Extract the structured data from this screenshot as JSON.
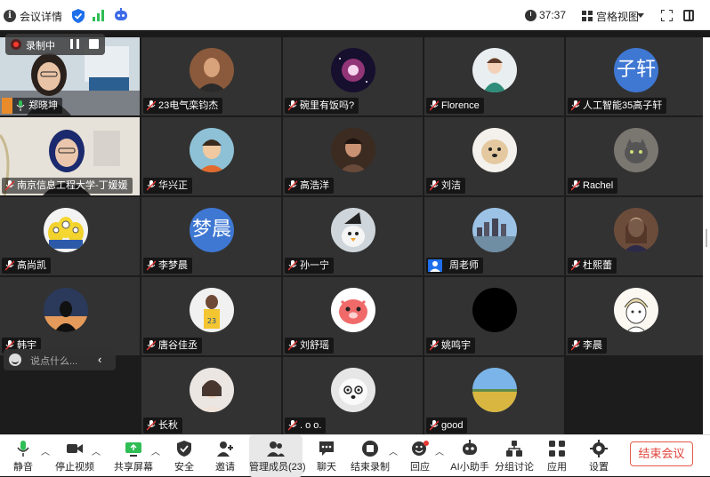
{
  "header": {
    "title": "会议详情",
    "timer": "37:37",
    "view_label": "宫格视图"
  },
  "recording": {
    "label": "录制中"
  },
  "participants": [
    {
      "name": "郑晓坤",
      "type": "video"
    },
    {
      "name": "23电气栾钧杰",
      "type": "avatar"
    },
    {
      "name": "碗里有饭吗?",
      "type": "avatar"
    },
    {
      "name": "Florence",
      "type": "avatar"
    },
    {
      "name": "人工智能35高子轩",
      "type": "avatar",
      "avatar_text": "子轩"
    },
    {
      "name": "南京信息工程大学-丁媛媛",
      "type": "video"
    },
    {
      "name": "华兴正",
      "type": "avatar"
    },
    {
      "name": "高浩洋",
      "type": "avatar"
    },
    {
      "name": "刘洁",
      "type": "avatar"
    },
    {
      "name": "Rachel",
      "type": "avatar"
    },
    {
      "name": "高尚凯",
      "type": "avatar"
    },
    {
      "name": "李梦晨",
      "type": "avatar",
      "avatar_text": "梦晨"
    },
    {
      "name": "孙一宁",
      "type": "avatar"
    },
    {
      "name": "周老师",
      "type": "avatar"
    },
    {
      "name": "杜熙蕾",
      "type": "avatar"
    },
    {
      "name": "韩宇",
      "type": "avatar"
    },
    {
      "name": "唐谷佳丞",
      "type": "avatar"
    },
    {
      "name": "刘舒瑶",
      "type": "avatar"
    },
    {
      "name": "姚鸣宇",
      "type": "avatar"
    },
    {
      "name": "李晨",
      "type": "avatar"
    },
    {
      "name": "长秋",
      "type": "avatar"
    },
    {
      "name": ". o o.",
      "type": "avatar"
    },
    {
      "name": "good",
      "type": "avatar"
    }
  ],
  "chat": {
    "placeholder": "说点什么..."
  },
  "toolbar": {
    "mute": "静音",
    "stop_video": "停止视频",
    "share_screen": "共享屏幕",
    "security": "安全",
    "invite": "邀请",
    "manage_members": "管理成员(23)",
    "chat": "聊天",
    "end_recording": "结束录制",
    "reactions": "回应",
    "ai_assistant": "AI小助手",
    "breakout": "分组讨论",
    "apps": "应用",
    "settings": "设置",
    "end_meeting": "结束会议"
  },
  "colors": {
    "accent_blue": "#1f6feb",
    "active_green": "#2fbd55",
    "end_red": "#e0443a"
  }
}
